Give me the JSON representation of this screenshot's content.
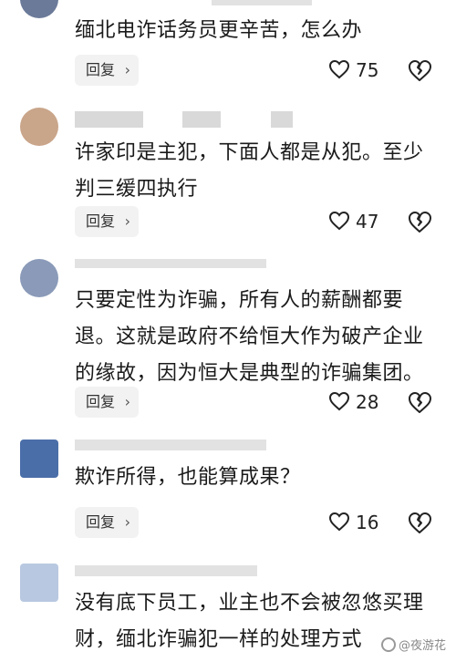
{
  "comments": [
    {
      "text": "缅北电诈话务员更辛苦，怎么办",
      "reply_label": "回复",
      "likes": "75"
    },
    {
      "text": "许家印是主犯，下面人都是从犯。至少判三缓四执行",
      "reply_label": "回复",
      "likes": "47"
    },
    {
      "text": "只要定性为诈骗，所有人的薪酬都要退。这就是政府不给恒大作为破产企业的缘故，因为恒大是典型的诈骗集团。",
      "reply_label": "回复",
      "likes": "28"
    },
    {
      "text": "欺诈所得，也能算成果？",
      "reply_label": "回复",
      "likes": "16"
    },
    {
      "text": "没有底下员工，业主也不会被忽悠买理财，缅北诈骗犯一样的处理方式",
      "reply_label": "回复",
      "likes": ""
    }
  ],
  "watermark": {
    "text": "@夜游花"
  },
  "icons": {
    "like": "heart-outline-icon",
    "dislike": "broken-heart-icon",
    "reply_chevron": "chevron-right-icon"
  }
}
